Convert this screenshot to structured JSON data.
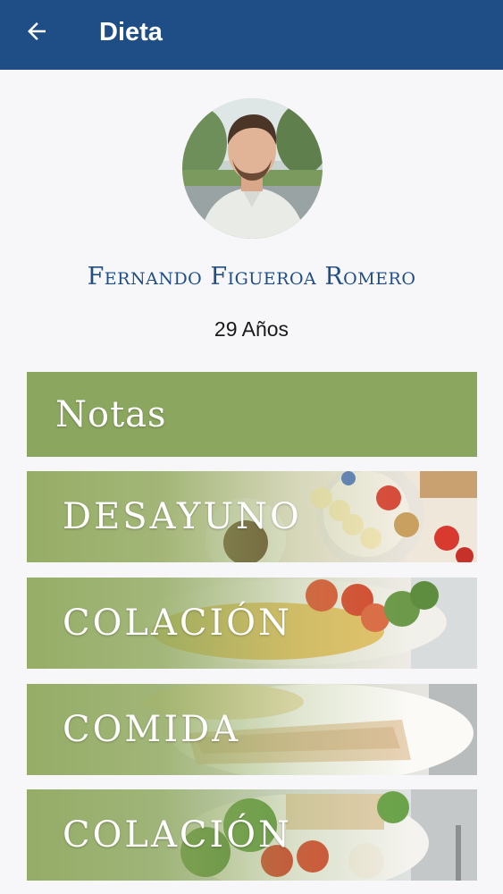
{
  "appbar": {
    "title": "Dieta",
    "back_icon": "arrow-left-icon",
    "color": "#1f4e87"
  },
  "profile": {
    "name": "Fernando Figueroa Romero",
    "age": "29 Años"
  },
  "cards": [
    {
      "label": "Notas",
      "color": "#8ba65e"
    },
    {
      "label": "DESAYUNO"
    },
    {
      "label": "COLACIÓN"
    },
    {
      "label": "COMIDA"
    },
    {
      "label": "COLACIÓN"
    }
  ]
}
